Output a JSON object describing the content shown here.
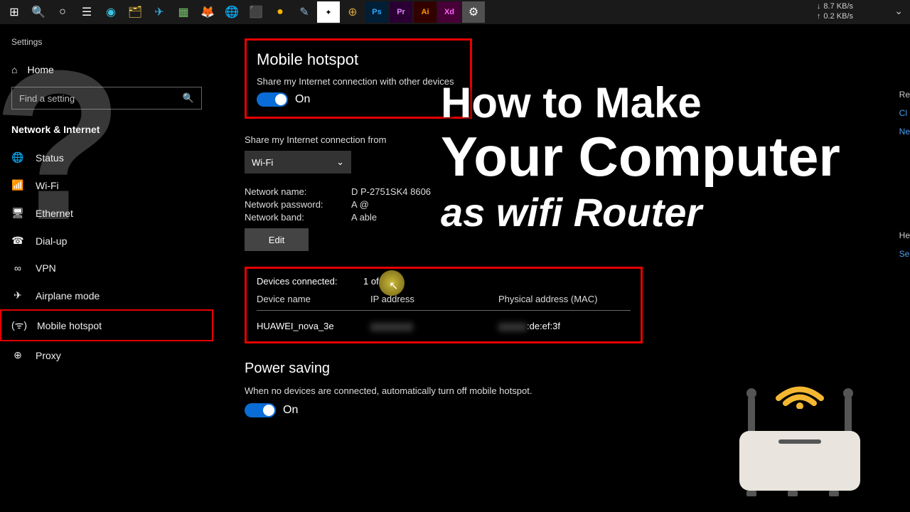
{
  "taskbar": {
    "netdown": "8.7 KB/s",
    "netup": "0.2 KB/s"
  },
  "sidebar": {
    "title": "Settings",
    "home": "Home",
    "search_placeholder": "Find a setting",
    "section": "Network & Internet",
    "items": [
      {
        "label": "Status"
      },
      {
        "label": "Wi-Fi"
      },
      {
        "label": "Ethernet"
      },
      {
        "label": "Dial-up"
      },
      {
        "label": "VPN"
      },
      {
        "label": "Airplane mode"
      },
      {
        "label": "Mobile hotspot"
      },
      {
        "label": "Proxy"
      }
    ]
  },
  "main": {
    "hotspot_title": "Mobile hotspot",
    "hotspot_sub": "Share my Internet connection with other devices",
    "toggle_on": "On",
    "share_from_label": "Share my Internet connection from",
    "share_from_value": "Wi-Fi",
    "net_name_lbl": "Network name:",
    "net_name_val": "D        P-2751SK4 8606",
    "net_pass_lbl": "Network password:",
    "net_pass_val": "A        @",
    "net_band_lbl": "Network band:",
    "net_band_val": "A        able",
    "edit": "Edit",
    "devices_lbl": "Devices connected:",
    "devices_val": "1 of 8",
    "col1": "Device name",
    "col2": "IP address",
    "col3": "Physical address (MAC)",
    "row_name": "HUAWEI_nova_3e",
    "row_mac": ":de:ef:3f",
    "power_title": "Power saving",
    "power_sub": "When no devices are connected, automatically turn off mobile hotspot.",
    "power_on": "On"
  },
  "overlay": {
    "l1": "How to Make",
    "l2": "Your Computer",
    "l3": "as wifi Router"
  },
  "rightpanel": {
    "re": "Re",
    "cl": "Cl",
    "ne": "Ne",
    "he": "He",
    "se": "Se"
  }
}
